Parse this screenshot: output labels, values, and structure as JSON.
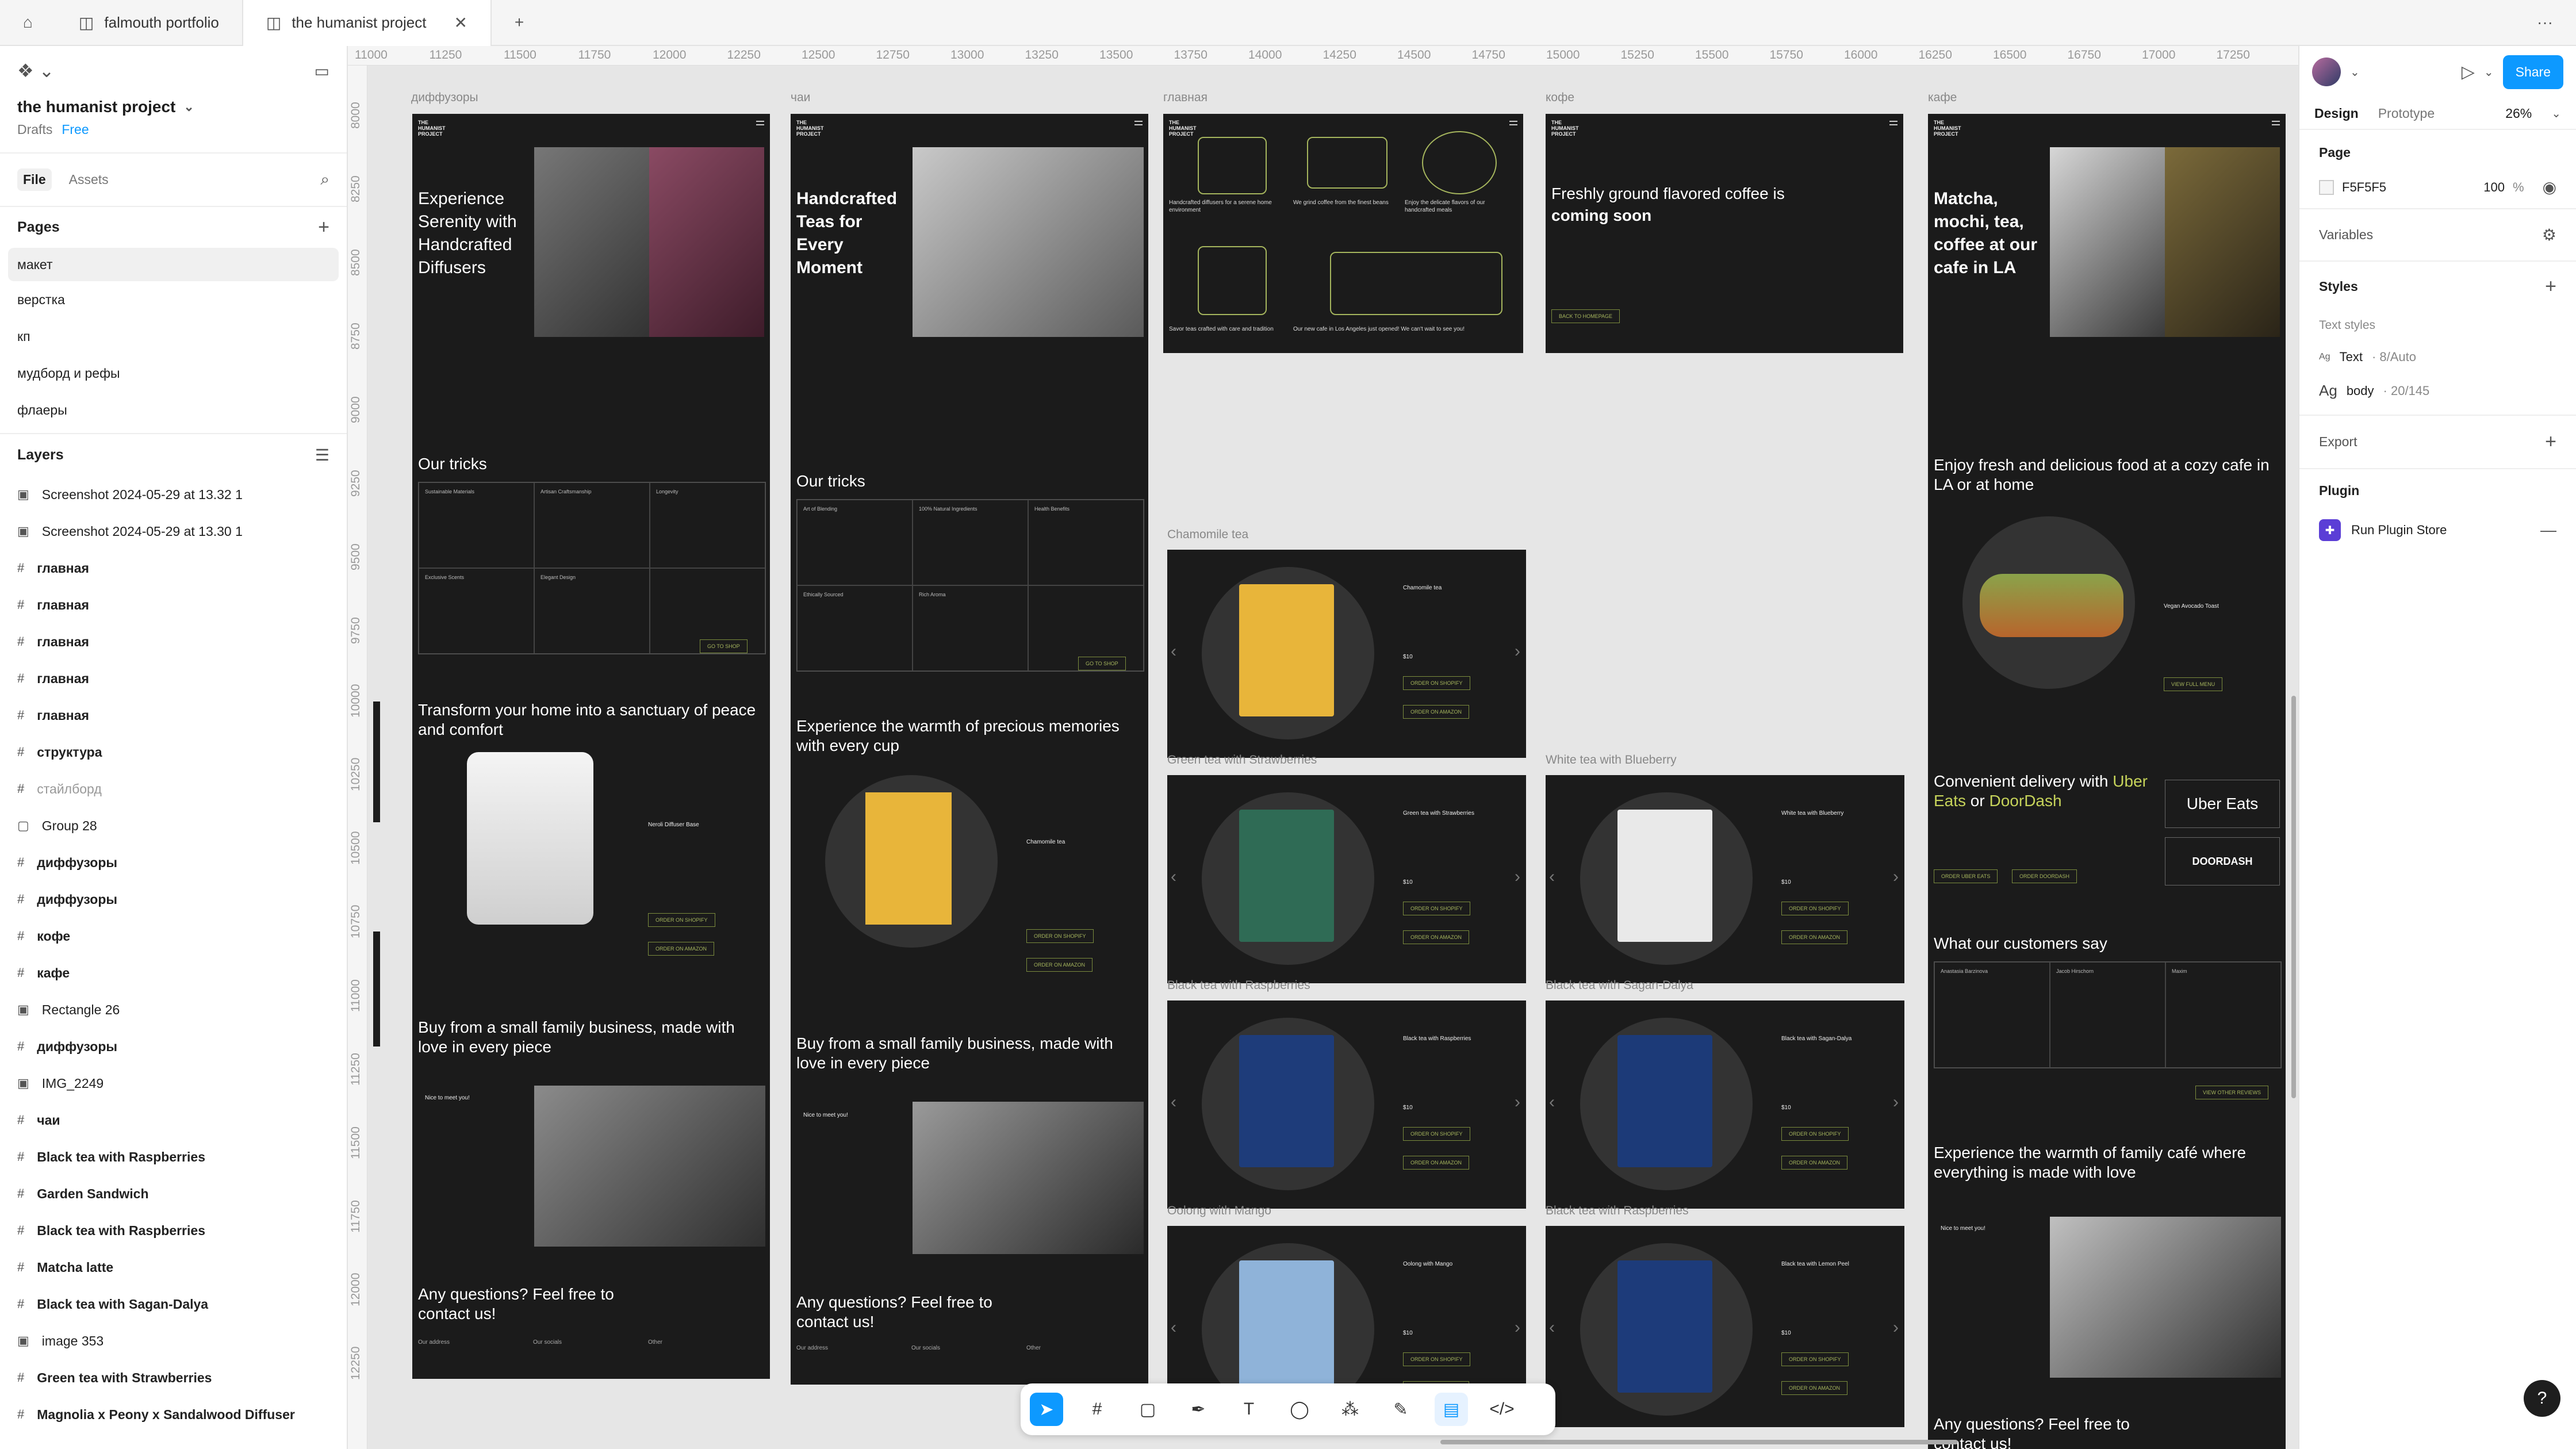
{
  "tabs": [
    {
      "label": "falmouth portfolio"
    },
    {
      "label": "the humanist project"
    }
  ],
  "left": {
    "project_name": "the humanist project",
    "location": "Drafts",
    "plan": "Free",
    "file_tab": "File",
    "assets_tab": "Assets",
    "pages_title": "Pages",
    "pages": [
      "макет",
      "верстка",
      "кп",
      "мудборд и рефы",
      "флаеры"
    ],
    "layers_title": "Layers",
    "layers": [
      {
        "icon": "image",
        "name": "Screenshot 2024-05-29 at 13.32 1"
      },
      {
        "icon": "image",
        "name": "Screenshot 2024-05-29 at 13.30 1"
      },
      {
        "icon": "frame",
        "name": "главная",
        "bold": true
      },
      {
        "icon": "frame",
        "name": "главная",
        "bold": true
      },
      {
        "icon": "frame",
        "name": "главная",
        "bold": true
      },
      {
        "icon": "frame",
        "name": "главная",
        "bold": true
      },
      {
        "icon": "frame",
        "name": "главная",
        "bold": true
      },
      {
        "icon": "frame",
        "name": "структура",
        "bold": true
      },
      {
        "icon": "frame",
        "name": "стайлборд",
        "muted": true
      },
      {
        "icon": "group",
        "name": "Group 28"
      },
      {
        "icon": "frame",
        "name": "диффузоры",
        "bold": true
      },
      {
        "icon": "frame",
        "name": "диффузоры",
        "bold": true
      },
      {
        "icon": "frame",
        "name": "кофе",
        "bold": true
      },
      {
        "icon": "frame",
        "name": "кафе",
        "bold": true
      },
      {
        "icon": "image",
        "name": "Rectangle 26"
      },
      {
        "icon": "frame",
        "name": "диффузоры",
        "bold": true
      },
      {
        "icon": "image",
        "name": "IMG_2249"
      },
      {
        "icon": "frame",
        "name": "чаи",
        "bold": true
      },
      {
        "icon": "frame",
        "name": "Black tea with Raspberries",
        "bold": true
      },
      {
        "icon": "frame",
        "name": "Garden Sandwich",
        "bold": true
      },
      {
        "icon": "frame",
        "name": "Black tea with Raspberries",
        "bold": true
      },
      {
        "icon": "frame",
        "name": "Matcha latte",
        "bold": true
      },
      {
        "icon": "frame",
        "name": "Black tea with Sagan-Dalya",
        "bold": true
      },
      {
        "icon": "image",
        "name": "image 353"
      },
      {
        "icon": "frame",
        "name": "Green tea with Strawberries",
        "bold": true
      },
      {
        "icon": "frame",
        "name": "Magnolia x Peony x Sandalwood Diffuser",
        "bold": true
      }
    ]
  },
  "ruler": {
    "top": [
      "11000",
      "11250",
      "11500",
      "11750",
      "12000",
      "12250",
      "12500",
      "12750",
      "13000",
      "13250",
      "13500",
      "13750",
      "14000",
      "14250",
      "14500",
      "14750",
      "15000",
      "15250",
      "15500",
      "15750",
      "16000",
      "16250",
      "16500",
      "16750",
      "17000",
      "17250"
    ],
    "left": [
      "8000",
      "8250",
      "8500",
      "8750",
      "9000",
      "9250",
      "9500",
      "9750",
      "10000",
      "10250",
      "10500",
      "10750",
      "11000",
      "11250",
      "11500",
      "11750",
      "12000",
      "12250"
    ]
  },
  "frames": {
    "diffusers": {
      "label": "диффузоры",
      "hero": "Experience Serenity with Handcrafted Diffusers",
      "tricks": "Our tricks",
      "cells": [
        "Sustainable Materials",
        "Artisan Craftsmanship",
        "Longevity",
        "Exclusive Scents",
        "Elegant Design",
        ""
      ],
      "goto": "GO TO SHOP",
      "transform": "Transform your home into a sanctuary of peace and comfort",
      "product": "Neroli Diffuser Base",
      "order1": "ORDER ON SHOPIFY",
      "order2": "ORDER ON AMAZON",
      "family": "Buy from a small family business, made with love in every piece",
      "meet": "Nice to meet you!",
      "questions": "Any questions? Feel free to contact us!",
      "footer": [
        "Our address",
        "Our socials",
        "Other"
      ]
    },
    "teas": {
      "label": "чаи",
      "hero": "Handcrafted Teas for Every Moment",
      "tricks": "Our tricks",
      "cells": [
        "Art of Blending",
        "100% Natural Ingredients",
        "Health Benefits",
        "Ethically Sourced",
        "Rich Aroma",
        ""
      ],
      "goto": "GO TO SHOP",
      "warmth": "Experience the warmth of precious memories with every cup",
      "product": "Chamomile tea",
      "order1": "ORDER ON SHOPIFY",
      "order2": "ORDER ON AMAZON",
      "family": "Buy from a small family business, made with love in every piece",
      "meet": "Nice to meet you!",
      "questions": "Any questions? Feel free to contact us!",
      "footer": [
        "Our address",
        "Our socials",
        "Other"
      ]
    },
    "main": {
      "label": "главная",
      "cells": [
        "Handcrafted diffusers for a serene home environment",
        "We grind coffee from the finest beans",
        "Enjoy the delicate flavors of our handcrafted meals",
        "Savor teas crafted with care and tradition",
        "Our new cafe in Los Angeles just opened! We can't wait to see you!"
      ]
    },
    "coffee": {
      "label": "кофе",
      "hero_a": "Freshly ground flavored coffee is ",
      "hero_b": "coming soon",
      "back": "BACK TO HOMEPAGE"
    },
    "cafe": {
      "label": "кафе",
      "hero": "Matcha, mochi, tea, coffee at our cafe in LA",
      "enjoy": "Enjoy fresh and delicious food at a cozy cafe in LA or at home",
      "dish": "Vegan Avocado Toast",
      "view": "VIEW FULL MENU",
      "delivery_a": "Convenient delivery with ",
      "uber": "Uber Eats",
      "or": " or ",
      "doordash": "DoorDash",
      "uber_logo": "Uber Eats",
      "doordash_logo": "DOORDASH",
      "order_uber": "ORDER UBER EATS",
      "order_dd": "ORDER DOORDASH",
      "customers": "What our customers say",
      "reviewers": [
        "Anastasia Barzinova",
        "Jacob Hirschorn",
        "Maxim"
      ],
      "view_reviews": "VIEW OTHER REVIEWS",
      "family": "Experience the warmth of family café where everything is made with love",
      "meet": "Nice to meet you!",
      "questions": "Any questions? Feel free to contact us!",
      "footer": [
        "Our address",
        "Our socials",
        "Other"
      ]
    },
    "tea_cards": [
      {
        "label": "Chamomile tea",
        "name": "Chamomile tea",
        "color": "#e8b53a"
      },
      {
        "label": "Green tea with Strawberries",
        "name": "Green tea with Strawberries",
        "color": "#2f6b55"
      },
      {
        "label": "White tea with Blueberry",
        "name": "White tea with Blueberry",
        "color": "#e9e9e9"
      },
      {
        "label": "Black tea with Raspberries",
        "name": "Black tea with Raspberries",
        "color": "#1e3c7a"
      },
      {
        "label": "Black tea with Sagan-Dalya",
        "name": "Black tea with Sagan-Dalya",
        "color": "#1c3a78"
      },
      {
        "label": "Oolong with Mango",
        "name": "Oolong with Mango",
        "color": "#8fb3d9"
      },
      {
        "label": "Black tea with Raspberries",
        "name": "Black tea with Lemon Peel",
        "color": "#1d3b7a"
      }
    ],
    "card_buttons": [
      "ORDER ON SHOPIFY",
      "ORDER ON AMAZON"
    ],
    "price": "$10"
  },
  "right": {
    "share": "Share",
    "design_tab": "Design",
    "prototype_tab": "Prototype",
    "zoom": "26%",
    "page_title": "Page",
    "page_color": "F5F5F5",
    "page_opacity": "100",
    "percent": "%",
    "variables": "Variables",
    "styles": "Styles",
    "text_styles": "Text styles",
    "style1_name": "Text",
    "style1_meta": " · 8/Auto",
    "style2_name": "body",
    "style2_meta": " · 20/145",
    "export": "Export",
    "plugin": "Plugin",
    "run_plugin": "Run Plugin Store"
  },
  "colors": {
    "accent": "#0d99ff",
    "frame_bg": "#1b1b1b",
    "olive": "#a5b55d"
  }
}
